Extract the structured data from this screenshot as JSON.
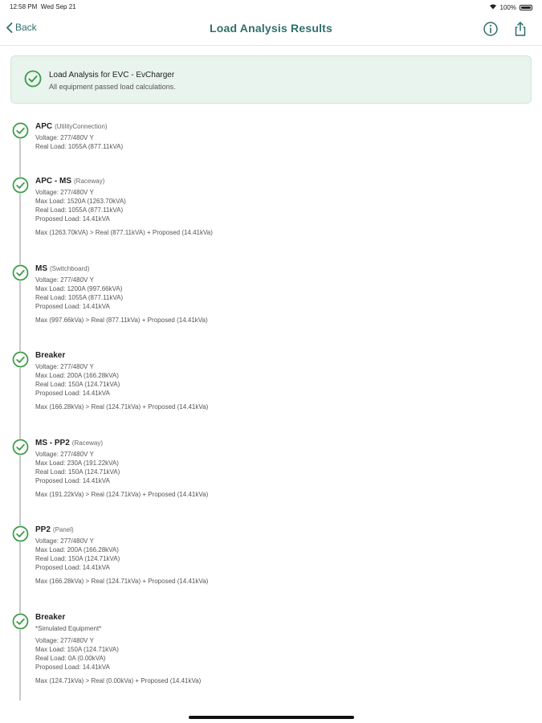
{
  "status_bar": {
    "time": "12:58 PM",
    "date": "Wed Sep 21",
    "battery": "100%"
  },
  "nav": {
    "back_label": "Back",
    "title": "Load Analysis Results",
    "info_icon": "info-icon",
    "share_icon": "share-icon"
  },
  "banner": {
    "title": "Load Analysis for EVC - EvCharger",
    "subtitle": "All equipment passed load calculations.",
    "icon": "check-circle-icon"
  },
  "colors": {
    "accent": "#2f6f6a",
    "success": "#3a9a45",
    "banner_bg": "#e9f4ee"
  },
  "items": [
    {
      "name": "APC",
      "type": "(UtilityConnection)",
      "note": "",
      "lines": [
        "Voltage: 277/480V Y",
        "Real Load: 1055A (877.11kVA)"
      ],
      "summary": ""
    },
    {
      "name": "APC - MS",
      "type": "(Raceway)",
      "note": "",
      "lines": [
        "Voltage: 277/480V Y",
        "Max Load: 1520A (1263.70kVA)",
        "Real Load: 1055A (877.11kVA)",
        "Proposed Load: 14.41kVA"
      ],
      "summary": "Max (1263.70kVA) > Real (877.11kVA) + Proposed (14.41kVa)"
    },
    {
      "name": "MS",
      "type": "(Switchboard)",
      "note": "",
      "lines": [
        "Voltage: 277/480V Y",
        "Max Load: 1200A (997.66kVA)",
        "Real Load: 1055A (877.11kVA)",
        "Proposed Load: 14.41kVA"
      ],
      "summary": "Max (997.66kVa) > Real (877.11kVa) + Proposed (14.41kVa)"
    },
    {
      "name": "Breaker",
      "type": "",
      "note": "",
      "lines": [
        "Voltage: 277/480V Y",
        "Max Load: 200A (166.28kVA)",
        "Real Load: 150A (124.71kVA)",
        "Proposed Load: 14.41kVA"
      ],
      "summary": "Max (166.28kVa) > Real (124.71kVa) + Proposed (14.41kVa)"
    },
    {
      "name": "MS - PP2",
      "type": "(Raceway)",
      "note": "",
      "lines": [
        "Voltage: 277/480V Y",
        "Max Load: 230A (191.22kVA)",
        "Real Load: 150A (124.71kVA)",
        "Proposed Load: 14.41kVA"
      ],
      "summary": "Max (191.22kVa) > Real (124.71kVa) + Proposed (14.41kVa)"
    },
    {
      "name": "PP2",
      "type": "(Panel)",
      "note": "",
      "lines": [
        "Voltage: 277/480V Y",
        "Max Load: 200A (166.28kVA)",
        "Real Load: 150A (124.71kVA)",
        "Proposed Load: 14.41kVA"
      ],
      "summary": "Max (166.28kVa) > Real (124.71kVa) + Proposed (14.41kVa)"
    },
    {
      "name": "Breaker",
      "type": "",
      "note": "*Simulated Equipment*",
      "lines": [
        "Voltage: 277/480V Y",
        "Max Load: 150A (124.71kVA)",
        "Real Load: 0A (0.00kVA)",
        "Proposed Load: 14.41kVA"
      ],
      "summary": "Max (124.71kVa) > Real (0.00kVa) + Proposed (14.41kVa)"
    }
  ]
}
